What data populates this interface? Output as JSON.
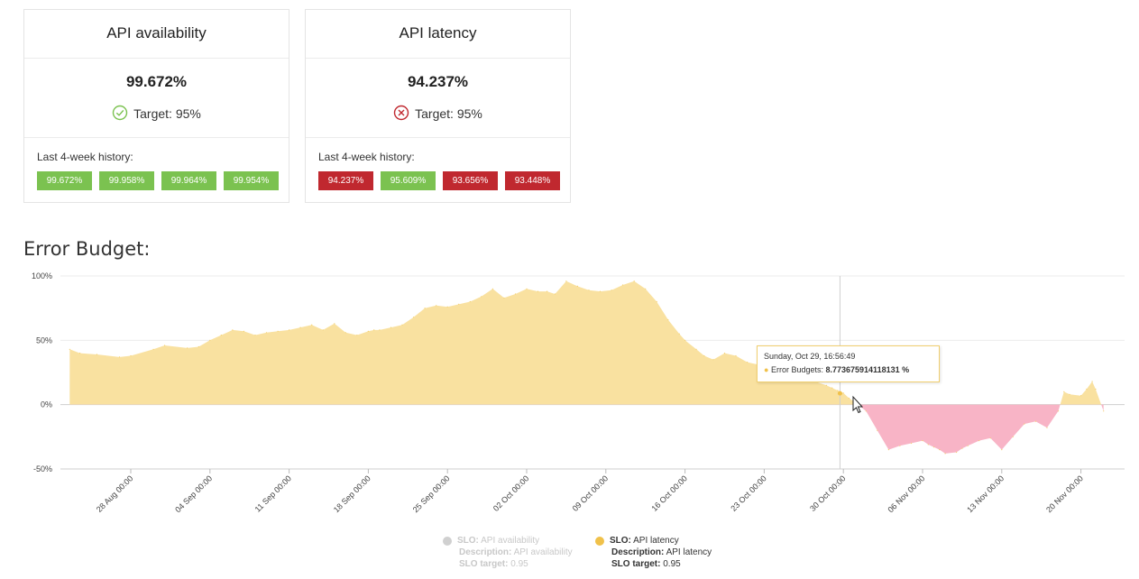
{
  "cards": [
    {
      "title": "API availability",
      "value": "99.672%",
      "status": "ok",
      "target": "Target: 95%",
      "history_label": "Last 4-week history:",
      "history": [
        {
          "label": "99.672%",
          "status": "ok"
        },
        {
          "label": "99.958%",
          "status": "ok"
        },
        {
          "label": "99.964%",
          "status": "ok"
        },
        {
          "label": "99.954%",
          "status": "ok"
        }
      ]
    },
    {
      "title": "API latency",
      "value": "94.237%",
      "status": "bad",
      "target": "Target: 95%",
      "history_label": "Last 4-week history:",
      "history": [
        {
          "label": "94.237%",
          "status": "bad"
        },
        {
          "label": "95.609%",
          "status": "ok"
        },
        {
          "label": "93.656%",
          "status": "bad"
        },
        {
          "label": "93.448%",
          "status": "bad"
        }
      ]
    }
  ],
  "section_title": "Error Budget:",
  "colors": {
    "ok": "#7bc250",
    "bad": "#c0282f",
    "area_positive": "#f9e1a0",
    "area_negative": "#f8b4c6",
    "latency_series": "#f0c14a",
    "availability_series_muted": "#d0d0d0"
  },
  "icons": {
    "ok": "check-circle-icon",
    "bad": "x-circle-icon"
  },
  "chart_data": {
    "type": "area",
    "ylim": [
      -50,
      100
    ],
    "yticks": [
      "100%",
      "50%",
      "0%",
      "-50%"
    ],
    "ytick_values": [
      100,
      50,
      0,
      -50
    ],
    "grid": true,
    "xticks": [
      "28 Aug 00:00",
      "04 Sep 00:00",
      "11 Sep 00:00",
      "18 Sep 00:00",
      "25 Sep 00:00",
      "02 Oct 00:00",
      "09 Oct 00:00",
      "16 Oct 00:00",
      "23 Oct 00:00",
      "30 Oct 00:00",
      "06 Nov 00:00",
      "13 Nov 00:00",
      "20 Nov 00:00"
    ],
    "xtick_days": [
      28,
      35,
      42,
      49,
      56,
      63,
      70,
      77,
      84,
      91,
      98,
      105,
      112
    ],
    "x_start_day": 22.6,
    "x_end_day": 114,
    "series": [
      {
        "name": "API latency",
        "x_days": [
          22.6,
          23.5,
          25,
          27,
          28,
          30,
          31,
          33,
          34,
          35,
          36,
          37,
          38,
          39,
          40,
          41,
          42,
          43,
          44,
          45,
          46,
          47,
          48,
          49,
          49.5,
          50,
          51,
          52,
          53,
          54,
          55,
          56,
          57,
          58,
          59,
          60,
          61,
          62,
          63,
          64,
          64.8,
          65.5,
          66.5,
          67.5,
          68.5,
          69.5,
          70.5,
          71.5,
          72.5,
          73.5,
          74.5,
          75.5,
          76.5,
          77,
          78,
          78.7,
          79.5,
          80.5,
          81.5,
          82.5,
          83.5,
          84.5,
          85.5,
          86.5,
          87.5,
          88.5,
          89.5,
          90,
          90.5,
          91,
          91.5,
          92,
          93,
          94,
          95,
          96,
          97,
          98,
          98.5,
          99,
          99.5,
          100,
          101,
          101.5,
          102,
          103,
          104,
          105,
          106,
          107,
          108,
          109,
          110,
          110.5,
          111,
          112,
          112.5,
          113,
          113.3,
          114
        ],
        "values": [
          43,
          40,
          39,
          37,
          38,
          43,
          46,
          44,
          45,
          50,
          54,
          58,
          57,
          54,
          56,
          57,
          58,
          60,
          62,
          58,
          63,
          56,
          54,
          57,
          58,
          58,
          60,
          62,
          68,
          75,
          77,
          76,
          78,
          80,
          84,
          90,
          83,
          86,
          90,
          88,
          88,
          86,
          96,
          92,
          89,
          88,
          89,
          93,
          96,
          90,
          80,
          66,
          55,
          50,
          43,
          38,
          35,
          40,
          38,
          33,
          31,
          29,
          28,
          25,
          22,
          18,
          15,
          13,
          11,
          9,
          5,
          2,
          -5,
          -20,
          -35,
          -32,
          -30,
          -28,
          -31,
          -33,
          -35,
          -38,
          -37,
          -34,
          -32,
          -28,
          -26,
          -35,
          -25,
          -15,
          -13,
          -18,
          -5,
          10,
          8,
          7,
          12,
          18,
          12,
          -5,
          -10,
          -16
        ]
      }
    ],
    "legend": [
      {
        "name": "API availability",
        "slo_label": "SLO:",
        "desc_label": "Description:",
        "description": "API availability",
        "target_label": "SLO target:",
        "target": "0.95",
        "active": false
      },
      {
        "name": "API latency",
        "slo_label": "SLO:",
        "desc_label": "Description:",
        "description": "API latency",
        "target_label": "SLO target:",
        "target": "0.95",
        "active": true
      }
    ],
    "tooltip": {
      "date": "Sunday, Oct 29, 16:56:49",
      "label": "Error Budgets:",
      "value": "8.773675914118131 %",
      "x_day": 90.7,
      "y_value": 8.77
    }
  }
}
